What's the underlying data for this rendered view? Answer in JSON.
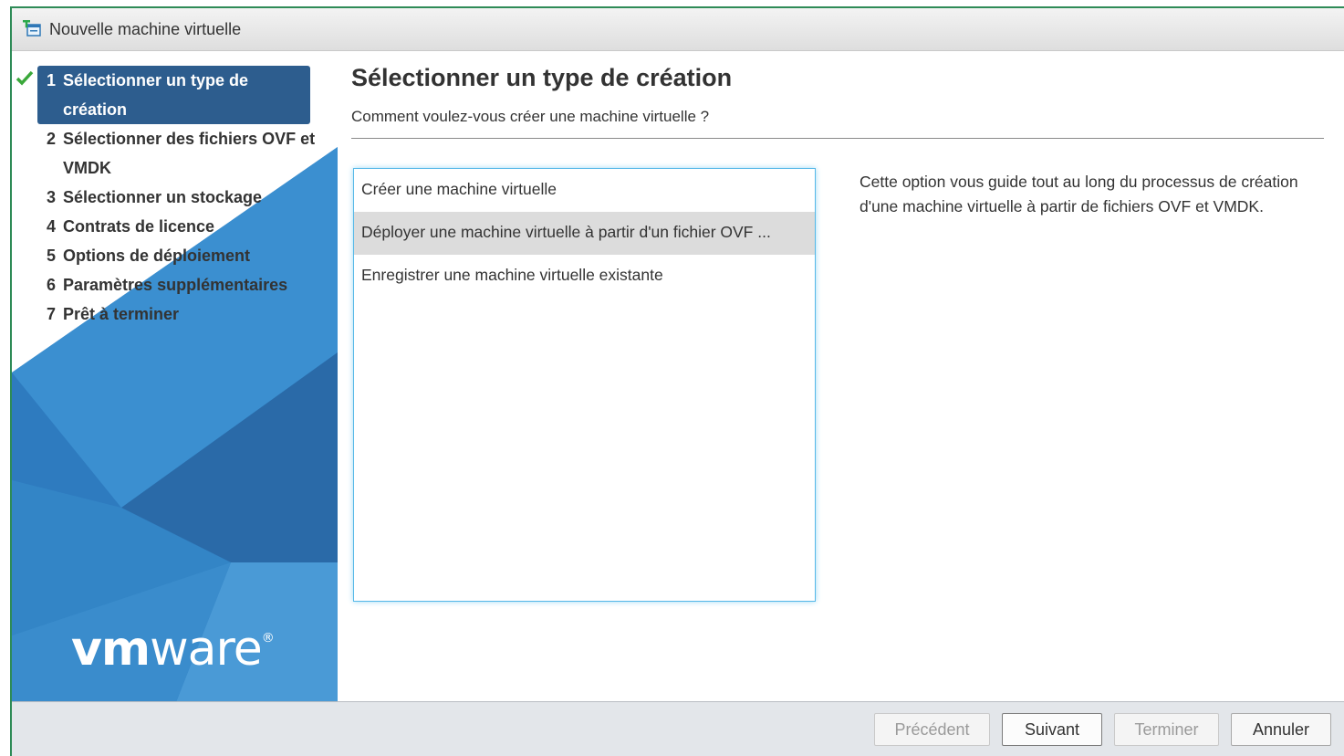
{
  "window": {
    "title": "Nouvelle machine virtuelle",
    "icon": "vm-add-icon"
  },
  "sidebar": {
    "steps": [
      {
        "num": "1",
        "label": "Sélectionner un type de création",
        "state": "active",
        "completed": true
      },
      {
        "num": "2",
        "label": "Sélectionner des fichiers OVF et VMDK"
      },
      {
        "num": "3",
        "label": "Sélectionner un stockage"
      },
      {
        "num": "4",
        "label": "Contrats de licence"
      },
      {
        "num": "5",
        "label": "Options de déploiement"
      },
      {
        "num": "6",
        "label": "Paramètres supplémentaires"
      },
      {
        "num": "7",
        "label": "Prêt à terminer"
      }
    ],
    "logo": {
      "bold": "vm",
      "light": "ware",
      "reg": "®"
    },
    "colors": {
      "accent": "#2d5d8e",
      "check": "#3aa83a"
    }
  },
  "main": {
    "heading": "Sélectionner un type de création",
    "subheading": "Comment voulez-vous créer une machine virtuelle ?",
    "options": [
      {
        "label": "Créer une machine virtuelle",
        "selected": false
      },
      {
        "label": "Déployer une machine virtuelle à partir d'un fichier OVF ...",
        "selected": true
      },
      {
        "label": "Enregistrer une machine virtuelle existante",
        "selected": false
      }
    ],
    "description": "Cette option vous guide tout au long du processus de création d'une machine virtuelle à partir de fichiers OVF et VMDK."
  },
  "footer": {
    "previous": "Précédent",
    "next": "Suivant",
    "finish": "Terminer",
    "cancel": "Annuler"
  }
}
